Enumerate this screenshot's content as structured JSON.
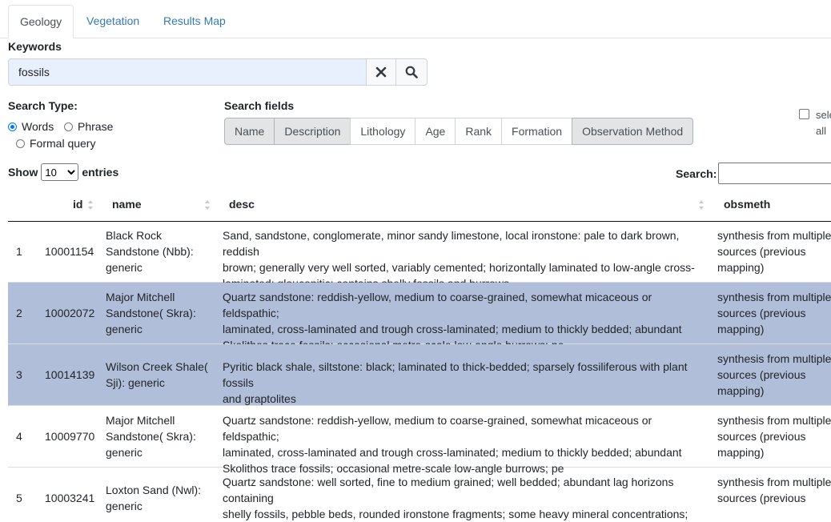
{
  "tabs": [
    {
      "label": "Geology",
      "active": true
    },
    {
      "label": "Vegetation",
      "active": false
    },
    {
      "label": "Results Map",
      "active": false
    }
  ],
  "keywords": {
    "label": "Keywords",
    "value": "fossils"
  },
  "icons": {
    "clear": "close-icon",
    "search": "search-icon"
  },
  "search_type": {
    "label": "Search Type:",
    "options": [
      {
        "label": "Words",
        "checked": true
      },
      {
        "label": "Phrase",
        "checked": false
      },
      {
        "label": "Formal query",
        "checked": false
      }
    ]
  },
  "search_fields": {
    "label": "Search fields",
    "fields": [
      {
        "label": "Name",
        "selected": true
      },
      {
        "label": "Description",
        "selected": true
      },
      {
        "label": "Lithology",
        "selected": false
      },
      {
        "label": "Age",
        "selected": false
      },
      {
        "label": "Rank",
        "selected": false
      },
      {
        "label": "Formation",
        "selected": false
      },
      {
        "label": "Observation Method",
        "selected": true
      }
    ],
    "select_all_line1": "sele",
    "select_all_line2": "all"
  },
  "length": {
    "show": "Show",
    "value": "10",
    "entries": "entries"
  },
  "table_search": {
    "label": "Search:"
  },
  "table": {
    "headers": {
      "id": "id",
      "name": "name",
      "desc": "desc",
      "obsmeth": "obsmeth"
    },
    "rows": [
      {
        "idx": "1",
        "id": "10001154",
        "name": [
          "Black Rock",
          "Sandstone (Nbb):",
          "generic"
        ],
        "desc": [
          "Sand, sandstone, conglomerate, minor sandy limestone, local ironstone: pale to dark brown, reddish",
          "brown; generally very well sorted, variably cemented; horizontally laminated to low-angle cross-",
          "laminated; glauconitic; contains shelly fossils and burrows"
        ],
        "obsmeth": [
          "synthesis from multiple",
          "sources (previous",
          "mapping)"
        ]
      },
      {
        "idx": "2",
        "id": "10002072",
        "name": [
          "Major Mitchell",
          "Sandstone( Skra):",
          "generic"
        ],
        "desc": [
          "Quartz sandstone: reddish-yellow, medium to coarse-grained, somewhat micaceous or feldspathic;",
          "laminated, cross-laminated and trough cross-laminated; medium to thickly bedded; abundant",
          "Skolithos trace fossils; occasional metre-scale low-angle burrows; pe"
        ],
        "obsmeth": [
          "synthesis from multiple",
          "sources (previous",
          "mapping)"
        ]
      },
      {
        "idx": "3",
        "id": "10014139",
        "name": [
          "Wilson Creek Shale(",
          "Sji): generic"
        ],
        "desc": [
          "Pyritic black shale, siltstone: black; laminated to thick-bedded; sparsely fossiliferous with plant fossils",
          "and graptolites"
        ],
        "obsmeth": [
          "synthesis from multiple",
          "sources (previous",
          "mapping)"
        ]
      },
      {
        "idx": "4",
        "id": "10009770",
        "name": [
          "Major Mitchell",
          "Sandstone( Skra):",
          "generic"
        ],
        "desc": [
          "Quartz sandstone: reddish-yellow, medium to coarse-grained, somewhat micaceous or feldspathic;",
          "laminated, cross-laminated and trough cross-laminated; medium to thickly bedded; abundant",
          "Skolithos trace fossils; occasional metre-scale low-angle burrows; pe"
        ],
        "obsmeth": [
          "synthesis from multiple",
          "sources (previous",
          "mapping)"
        ]
      },
      {
        "idx": "5",
        "id": "10003241",
        "name": [
          "Loxton Sand (Nwl):",
          "generic"
        ],
        "desc": [
          "Quartz sandstone: well sorted, fine to medium grained; well bedded; abundant lag horizons containing",
          "shelly fossils, pebble beds, rounded ironstone fragments; some heavy mineral concentrations;"
        ],
        "obsmeth": [
          "synthesis from multiple",
          "sources (previous"
        ]
      }
    ]
  }
}
